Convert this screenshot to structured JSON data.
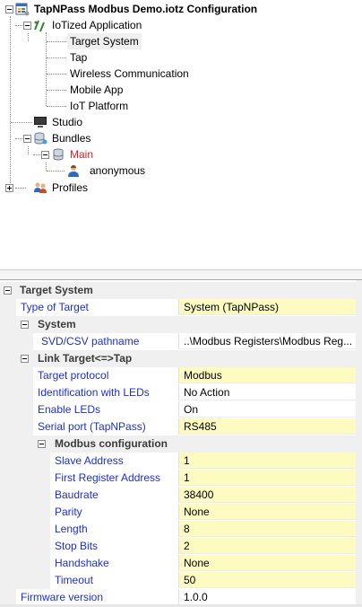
{
  "tree": {
    "root": "TapNPass Modbus Demo.iotz Configuration",
    "iotized": "IoTized Application",
    "children": [
      "Target System",
      "Tap",
      "Wireless Communication",
      "Mobile App",
      "IoT Platform"
    ],
    "studio": "Studio",
    "bundles": "Bundles",
    "main": "Main",
    "anonymous": "anonymous",
    "profiles": "Profiles"
  },
  "props": {
    "target_system": "Target System",
    "type_of_target": {
      "label": "Type of Target",
      "value": "System (TapNPass)"
    },
    "system_cat": "System",
    "svd": {
      "label": "SVD/CSV pathname",
      "value": "..\\Modbus Registers\\Modbus Reg..."
    },
    "link_cat": "Link Target<=>Tap",
    "target_protocol": {
      "label": "Target protocol",
      "value": "Modbus"
    },
    "identification": {
      "label": "Identification with LEDs",
      "value": "No Action"
    },
    "enable_leds": {
      "label": "Enable LEDs",
      "value": "On"
    },
    "serial_port": {
      "label": "Serial port (TapNPass)",
      "value": "RS485"
    },
    "modbus_cat": "Modbus configuration",
    "slave_address": {
      "label": "Slave Address",
      "value": "1"
    },
    "first_register": {
      "label": "First Register Address",
      "value": "1"
    },
    "baudrate": {
      "label": "Baudrate",
      "value": "38400"
    },
    "parity": {
      "label": "Parity",
      "value": "None"
    },
    "length": {
      "label": "Length",
      "value": "8"
    },
    "stop_bits": {
      "label": "Stop Bits",
      "value": "2"
    },
    "handshake": {
      "label": "Handshake",
      "value": "None"
    },
    "timeout": {
      "label": "Timeout",
      "value": "50"
    },
    "firmware": {
      "label": "Firmware version",
      "value": "1.0.0"
    }
  },
  "colors": {
    "value_highlight": "#fefbc0",
    "label_blue": "#1d2fd0",
    "main_red": "#e02020"
  }
}
